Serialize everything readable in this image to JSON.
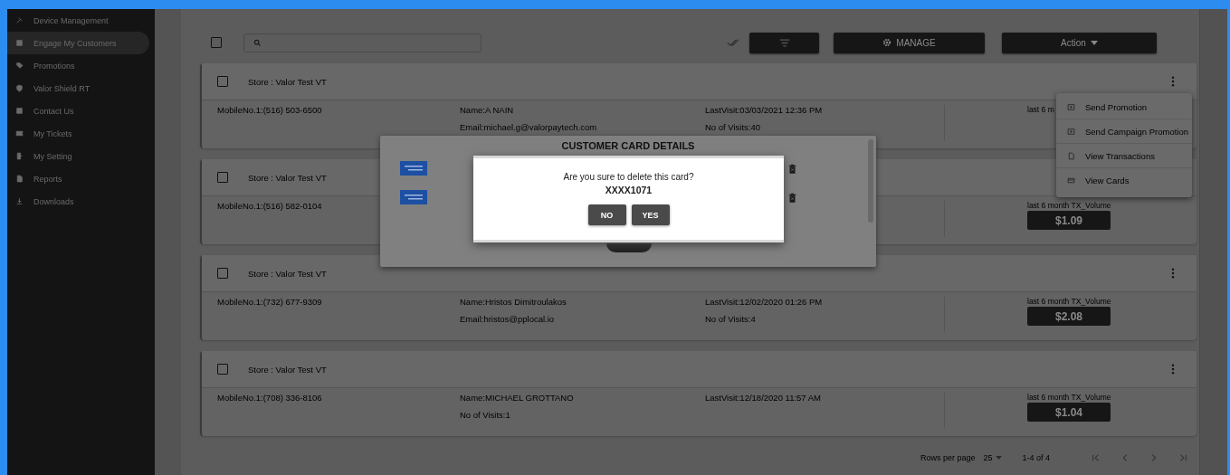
{
  "sidebar": {
    "items": [
      {
        "label": "Device Management",
        "selected": false
      },
      {
        "label": "Engage My Customers",
        "selected": true
      },
      {
        "label": "Promotions",
        "selected": false
      },
      {
        "label": "Valor Shield RT",
        "selected": false
      },
      {
        "label": "Contact Us",
        "selected": false
      },
      {
        "label": "My Tickets",
        "selected": false
      },
      {
        "label": "My Setting",
        "selected": false
      },
      {
        "label": "Reports",
        "selected": false
      },
      {
        "label": "Downloads",
        "selected": false
      }
    ]
  },
  "toolbar": {
    "select_all": {
      "checked": false
    },
    "manage_button": "MANAGE",
    "action_button": "Action"
  },
  "cards": [
    {
      "store": "Store : Valor Test VT",
      "checked": false,
      "mobile": "MobileNo.1:(516) 503-6500",
      "name_lines": [
        "Name:A NAIN",
        "Email:michael.g@valorpaytech.com"
      ],
      "visit_lines": [
        "LastVisit:03/03/2021 12:36 PM",
        "No of Visits:40"
      ],
      "volume_label": "last 6 m"
    },
    {
      "store": "Store : Valor Test VT",
      "checked": false,
      "mobile": "MobileNo.1:(516) 582-0104",
      "volume_label": "last 6 month TX_Volume",
      "amount": "$1.09"
    },
    {
      "store": "Store : Valor Test VT",
      "checked": false,
      "mobile": "MobileNo.1:(732) 677-9309",
      "name_lines": [
        "Name:Hristos Dimitroulakos",
        "Email:hristos@pplocal.io"
      ],
      "visit_lines": [
        "LastVisit:12/02/2020 01:26 PM",
        "No of Visits:4"
      ],
      "volume_label": "last 6 month TX_Volume",
      "amount": "$2.08"
    },
    {
      "store": "Store : Valor Test VT",
      "checked": false,
      "mobile": "MobileNo.1:(708) 336-8106",
      "name_lines": [
        "Name:MICHAEL GROTTANO",
        "No of Visits:1"
      ],
      "visit_lines": [
        "LastVisit:12/18/2020 11:57 AM"
      ],
      "volume_label": "last 6 month TX_Volume",
      "amount": "$1.04"
    }
  ],
  "context_menu": {
    "items": [
      {
        "label": "Send Promotion"
      },
      {
        "label": "Send Campaign Promotion"
      },
      {
        "label": "View Transactions"
      },
      {
        "label": "View Cards"
      }
    ]
  },
  "pagination": {
    "rows_label": "Rows per page",
    "rows_value": "25",
    "range": "1-4 of 4"
  },
  "card_dialog": {
    "title": "CUSTOMER CARD DETAILS",
    "cards": [
      {
        "kind": "amex"
      },
      {
        "kind": "amex"
      }
    ]
  },
  "confirm_dialog": {
    "message": "Are you sure to delete this card?",
    "card_number": "XXXX1071",
    "buttons": [
      "NO",
      "YES"
    ]
  }
}
